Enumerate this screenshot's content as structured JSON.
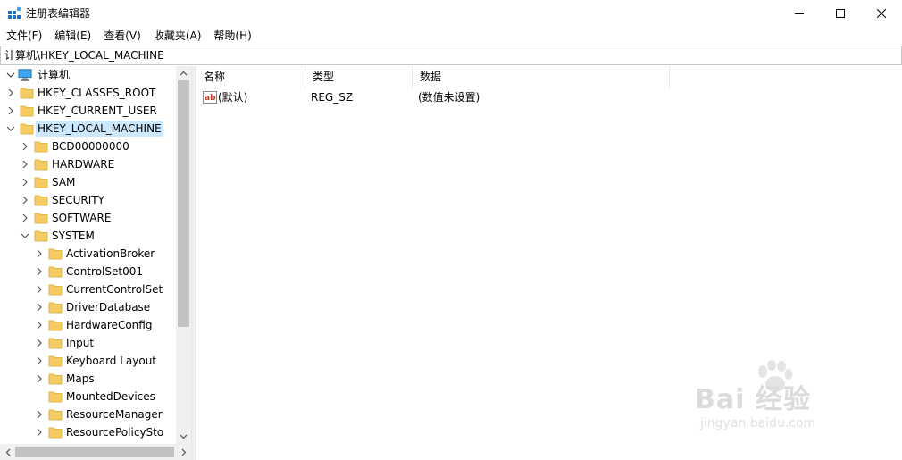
{
  "window": {
    "title": "注册表编辑器"
  },
  "menu": [
    "文件(F)",
    "编辑(E)",
    "查看(V)",
    "收藏夹(A)",
    "帮助(H)"
  ],
  "address": "计算机\\HKEY_LOCAL_MACHINE",
  "tree": {
    "root": "计算机",
    "items": [
      {
        "label": "HKEY_CLASSES_ROOT",
        "level": 1,
        "expanded": false,
        "selected": false
      },
      {
        "label": "HKEY_CURRENT_USER",
        "level": 1,
        "expanded": false,
        "selected": false
      },
      {
        "label": "HKEY_LOCAL_MACHINE",
        "level": 1,
        "expanded": true,
        "selected": true
      },
      {
        "label": "BCD00000000",
        "level": 2,
        "expanded": false,
        "selected": false
      },
      {
        "label": "HARDWARE",
        "level": 2,
        "expanded": false,
        "selected": false
      },
      {
        "label": "SAM",
        "level": 2,
        "expanded": false,
        "selected": false
      },
      {
        "label": "SECURITY",
        "level": 2,
        "expanded": false,
        "selected": false
      },
      {
        "label": "SOFTWARE",
        "level": 2,
        "expanded": false,
        "selected": false
      },
      {
        "label": "SYSTEM",
        "level": 2,
        "expanded": true,
        "selected": false
      },
      {
        "label": "ActivationBroker",
        "level": 3,
        "expanded": false,
        "selected": false
      },
      {
        "label": "ControlSet001",
        "level": 3,
        "expanded": false,
        "selected": false
      },
      {
        "label": "CurrentControlSet",
        "level": 3,
        "expanded": false,
        "selected": false
      },
      {
        "label": "DriverDatabase",
        "level": 3,
        "expanded": false,
        "selected": false
      },
      {
        "label": "HardwareConfig",
        "level": 3,
        "expanded": false,
        "selected": false
      },
      {
        "label": "Input",
        "level": 3,
        "expanded": false,
        "selected": false
      },
      {
        "label": "Keyboard Layout",
        "level": 3,
        "expanded": false,
        "selected": false
      },
      {
        "label": "Maps",
        "level": 3,
        "expanded": false,
        "selected": false
      },
      {
        "label": "MountedDevices",
        "level": 3,
        "expanded": false,
        "selected": false,
        "no_chevron": true
      },
      {
        "label": "ResourceManager",
        "level": 3,
        "expanded": false,
        "selected": false
      },
      {
        "label": "ResourcePolicySto",
        "level": 3,
        "expanded": false,
        "selected": false
      }
    ]
  },
  "list": {
    "columns": [
      "名称",
      "类型",
      "数据"
    ],
    "rows": [
      {
        "name": "(默认)",
        "type": "REG_SZ",
        "data": "(数值未设置)",
        "icon": "string-value-icon"
      }
    ]
  },
  "watermark": {
    "brand": "Bai 经验",
    "site": "jingyan.baidu.com"
  },
  "colors": {
    "selection": "#cce8ff",
    "folder": "#f4cc63",
    "scrollbar_thumb": "#c2c2c2"
  }
}
